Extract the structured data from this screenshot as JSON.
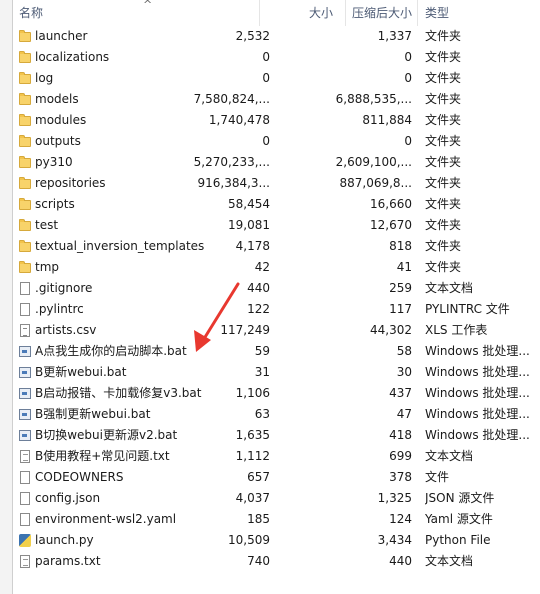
{
  "columns": {
    "name": "名称",
    "size": "大小",
    "compressed": "压缩后大小",
    "type": "类型"
  },
  "files": [
    {
      "name": "launcher",
      "size": "2,532",
      "compressed": "1,337",
      "type": "文件夹",
      "icon": "folder-icon"
    },
    {
      "name": "localizations",
      "size": "0",
      "compressed": "0",
      "type": "文件夹",
      "icon": "folder-icon"
    },
    {
      "name": "log",
      "size": "0",
      "compressed": "0",
      "type": "文件夹",
      "icon": "folder-icon"
    },
    {
      "name": "models",
      "size": "7,580,824,...",
      "compressed": "6,888,535,...",
      "type": "文件夹",
      "icon": "folder-icon"
    },
    {
      "name": "modules",
      "size": "1,740,478",
      "compressed": "811,884",
      "type": "文件夹",
      "icon": "folder-icon"
    },
    {
      "name": "outputs",
      "size": "0",
      "compressed": "0",
      "type": "文件夹",
      "icon": "folder-icon"
    },
    {
      "name": "py310",
      "size": "5,270,233,...",
      "compressed": "2,609,100,...",
      "type": "文件夹",
      "icon": "folder-icon"
    },
    {
      "name": "repositories",
      "size": "916,384,3...",
      "compressed": "887,069,8...",
      "type": "文件夹",
      "icon": "folder-icon"
    },
    {
      "name": "scripts",
      "size": "58,454",
      "compressed": "16,660",
      "type": "文件夹",
      "icon": "folder-icon"
    },
    {
      "name": "test",
      "size": "19,081",
      "compressed": "12,670",
      "type": "文件夹",
      "icon": "folder-icon"
    },
    {
      "name": "textual_inversion_templates",
      "size": "4,178",
      "compressed": "818",
      "type": "文件夹",
      "icon": "folder-icon"
    },
    {
      "name": "tmp",
      "size": "42",
      "compressed": "41",
      "type": "文件夹",
      "icon": "folder-icon"
    },
    {
      "name": ".gitignore",
      "size": "440",
      "compressed": "259",
      "type": "文本文档",
      "icon": "document-icon"
    },
    {
      "name": ".pylintrc",
      "size": "122",
      "compressed": "117",
      "type": "PYLINTRC 文件",
      "icon": "document-icon"
    },
    {
      "name": "artists.csv",
      "size": "117,249",
      "compressed": "44,302",
      "type": "XLS 工作表",
      "icon": "csv-icon"
    },
    {
      "name": "A点我生成你的启动脚本.bat",
      "size": "59",
      "compressed": "58",
      "type": "Windows 批处理...",
      "icon": "batch-file-icon"
    },
    {
      "name": "B更新webui.bat",
      "size": "31",
      "compressed": "30",
      "type": "Windows 批处理...",
      "icon": "batch-file-icon"
    },
    {
      "name": "B启动报错、卡加载修复v3.bat",
      "size": "1,106",
      "compressed": "437",
      "type": "Windows 批处理...",
      "icon": "batch-file-icon"
    },
    {
      "name": "B强制更新webui.bat",
      "size": "63",
      "compressed": "47",
      "type": "Windows 批处理...",
      "icon": "batch-file-icon"
    },
    {
      "name": "B切换webui更新源v2.bat",
      "size": "1,635",
      "compressed": "418",
      "type": "Windows 批处理...",
      "icon": "batch-file-icon"
    },
    {
      "name": "B使用教程+常见问题.txt",
      "size": "1,112",
      "compressed": "699",
      "type": "文本文档",
      "icon": "text-file-icon"
    },
    {
      "name": "CODEOWNERS",
      "size": "657",
      "compressed": "378",
      "type": "文件",
      "icon": "document-icon"
    },
    {
      "name": "config.json",
      "size": "4,037",
      "compressed": "1,325",
      "type": "JSON 源文件",
      "icon": "document-icon"
    },
    {
      "name": "environment-wsl2.yaml",
      "size": "185",
      "compressed": "124",
      "type": "Yaml 源文件",
      "icon": "document-icon"
    },
    {
      "name": "launch.py",
      "size": "10,509",
      "compressed": "3,434",
      "type": "Python File",
      "icon": "python-file-icon"
    },
    {
      "name": "params.txt",
      "size": "740",
      "compressed": "440",
      "type": "文本文档",
      "icon": "text-file-icon"
    }
  ],
  "annotation_color": "#e8382f"
}
